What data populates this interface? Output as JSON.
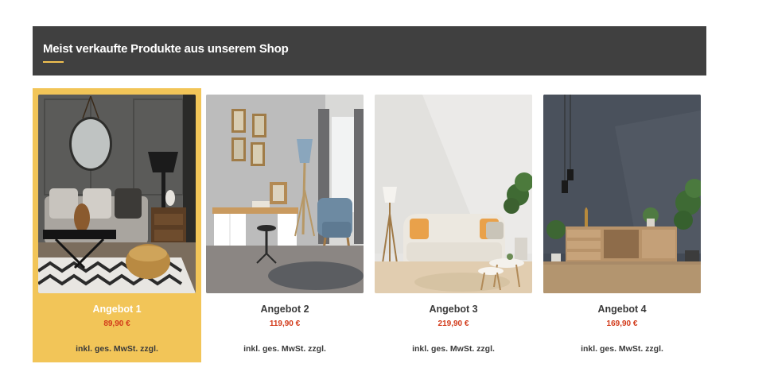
{
  "section": {
    "title": "Meist verkaufte Produkte aus unserem Shop",
    "accent_color": "#f0c050",
    "header_bg": "#404040"
  },
  "products": [
    {
      "name": "Angebot 1",
      "price": "89,90 €",
      "tax_note": "inkl. ges. MwSt. zzgl.",
      "highlighted": true,
      "image": "living-room-mirror-lamp-pouf"
    },
    {
      "name": "Angebot 2",
      "price": "119,90 €",
      "tax_note": "inkl. ges. MwSt. zzgl.",
      "highlighted": false,
      "image": "home-office-desk-armchair"
    },
    {
      "name": "Angebot 3",
      "price": "219,90 €",
      "tax_note": "inkl. ges. MwSt. zzgl.",
      "highlighted": false,
      "image": "bright-room-white-sofa"
    },
    {
      "name": "Angebot 4",
      "price": "169,90 €",
      "tax_note": "inkl. ges. MwSt. zzgl.",
      "highlighted": false,
      "image": "dark-wall-wooden-sideboard"
    }
  ],
  "colors": {
    "highlight": "#f2c558",
    "price": "#d23a1a",
    "text": "#3a3a3a"
  }
}
